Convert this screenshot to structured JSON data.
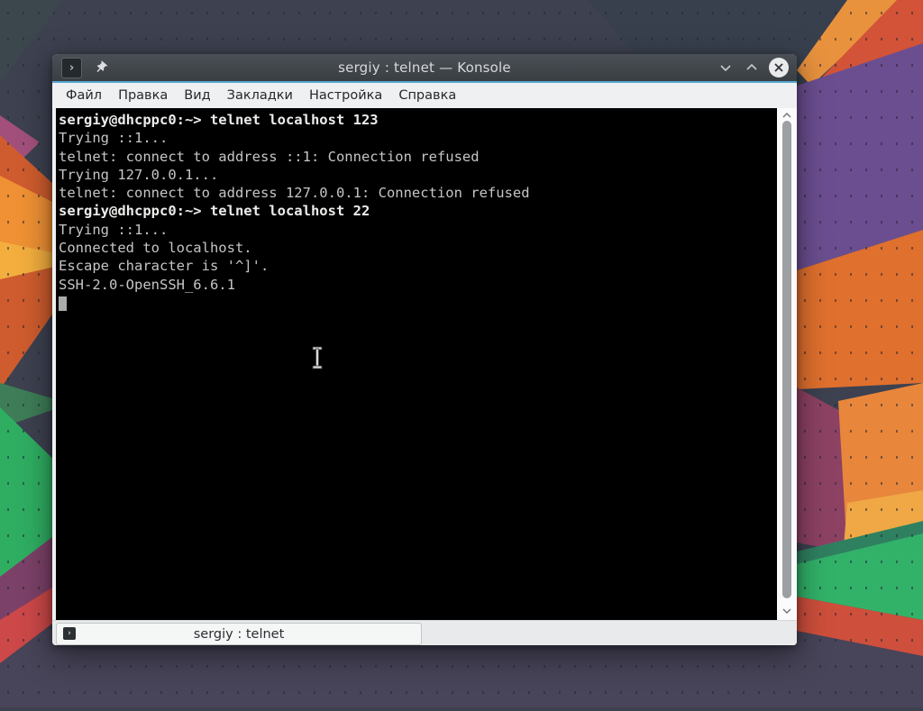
{
  "window": {
    "title": "sergiy : telnet — Konsole",
    "app_icon_glyph": "›",
    "accent_color": "#57a6d3",
    "titlebar_color": "#3e4348"
  },
  "menu": {
    "items": [
      "Файл",
      "Правка",
      "Вид",
      "Закладки",
      "Настройка",
      "Справка"
    ]
  },
  "terminal": {
    "background": "#000000",
    "foreground": "#c5c6c4",
    "bold_foreground": "#ecedeb",
    "lines": [
      {
        "text": "sergiy@dhcppc0:~> telnet localhost 123",
        "bold": true
      },
      {
        "text": "Trying ::1...",
        "bold": false
      },
      {
        "text": "telnet: connect to address ::1: Connection refused",
        "bold": false
      },
      {
        "text": "Trying 127.0.0.1...",
        "bold": false
      },
      {
        "text": "telnet: connect to address 127.0.0.1: Connection refused",
        "bold": false
      },
      {
        "text": "sergiy@dhcppc0:~> telnet localhost 22",
        "bold": true
      },
      {
        "text": "Trying ::1...",
        "bold": false
      },
      {
        "text": "Connected to localhost.",
        "bold": false
      },
      {
        "text": "Escape character is '^]'.",
        "bold": false
      },
      {
        "text": "SSH-2.0-OpenSSH_6.6.1",
        "bold": false
      },
      {
        "text": "",
        "bold": false
      }
    ]
  },
  "tabbar": {
    "active_label": "sergiy : telnet",
    "tab_icon_glyph": "›"
  },
  "wallpaper": {
    "base": "#3d4150",
    "orange": "#e0702e",
    "bright_orange": "#ef9134",
    "green": "#2fae62",
    "purple": "#6b4e90",
    "maroon": "#8d4263",
    "crimson": "#cd4848"
  }
}
